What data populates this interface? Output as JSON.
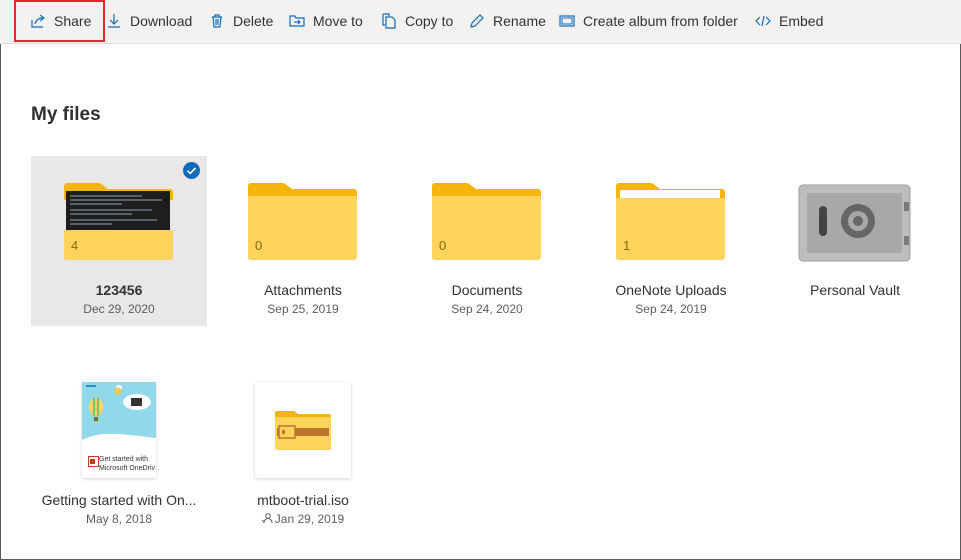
{
  "toolbar": {
    "share_label": "Share",
    "download_label": "Download",
    "delete_label": "Delete",
    "move_label": "Move to",
    "copy_label": "Copy to",
    "rename_label": "Rename",
    "album_label": "Create album from folder",
    "embed_label": "Embed"
  },
  "page": {
    "title": "My files"
  },
  "items": [
    {
      "name": "123456",
      "date": "Dec 29, 2020",
      "count": "4",
      "selected": true
    },
    {
      "name": "Attachments",
      "date": "Sep 25, 2019",
      "count": "0"
    },
    {
      "name": "Documents",
      "date": "Sep 24, 2020",
      "count": "0"
    },
    {
      "name": "OneNote Uploads",
      "date": "Sep 24, 2019",
      "count": "1"
    },
    {
      "name": "Personal Vault"
    },
    {
      "name": "Getting started with On...",
      "date": "May 8, 2018",
      "thumb_text": "Get started with\nMicrosoft OneDrive"
    },
    {
      "name": "mtboot-trial.iso",
      "date": "Jan 29, 2019",
      "shared": true
    }
  ],
  "colors": {
    "accent": "#0f6cbd",
    "folder": "#ffd35c",
    "folder_tab": "#f5b50d",
    "highlight": "#e0282e"
  }
}
